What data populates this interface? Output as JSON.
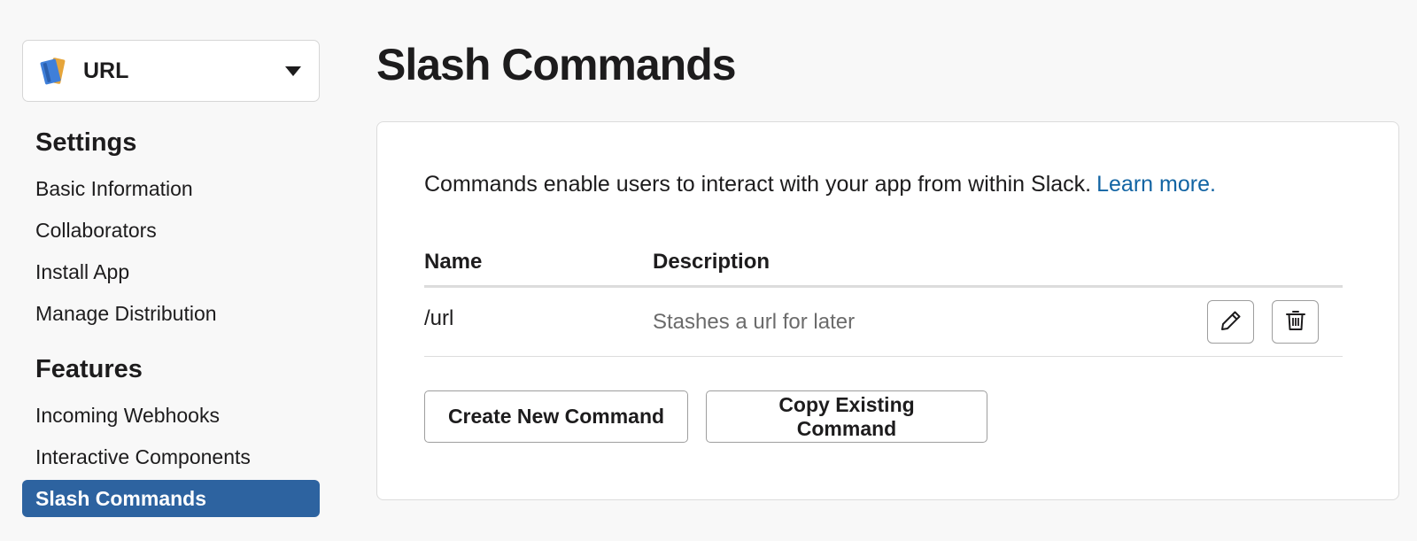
{
  "app": {
    "name": "URL",
    "icon": "book-icon"
  },
  "sidebar": {
    "settings_title": "Settings",
    "settings_items": [
      {
        "label": "Basic Information"
      },
      {
        "label": "Collaborators"
      },
      {
        "label": "Install App"
      },
      {
        "label": "Manage Distribution"
      }
    ],
    "features_title": "Features",
    "features_items": [
      {
        "label": "Incoming Webhooks",
        "active": false
      },
      {
        "label": "Interactive Components",
        "active": false
      },
      {
        "label": "Slash Commands",
        "active": true
      }
    ]
  },
  "main": {
    "title": "Slash Commands",
    "intro": "Commands enable users to interact with your app from within Slack.",
    "learn_more": "Learn more.",
    "table": {
      "headers": {
        "name": "Name",
        "description": "Description"
      },
      "rows": [
        {
          "name": "/url",
          "description": "Stashes a url for later"
        }
      ]
    },
    "buttons": {
      "create": "Create New Command",
      "copy": "Copy Existing Command"
    }
  },
  "colors": {
    "accent": "#2d63a0",
    "link": "#1264a3",
    "background": "#f8f8f8"
  }
}
